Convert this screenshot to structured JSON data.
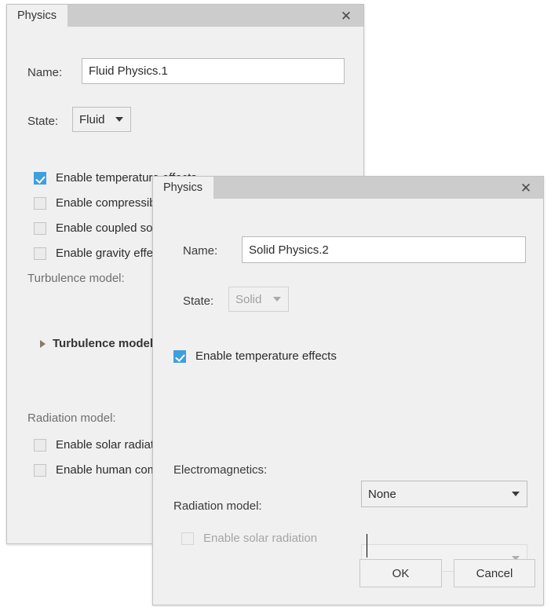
{
  "background_dialog": {
    "tab_label": "Physics",
    "close_icon": "close-icon",
    "name": {
      "label": "Name:",
      "value": "Fluid Physics.1"
    },
    "state": {
      "label": "State:",
      "value": "Fluid",
      "enabled": true
    },
    "checkboxes": [
      {
        "label": "Enable temperature effects",
        "checked": true,
        "enabled": true
      },
      {
        "label": "Enable compressibility",
        "checked": false,
        "enabled": true
      },
      {
        "label": "Enable coupled solver",
        "checked": false,
        "enabled": true
      },
      {
        "label": "Enable gravity effects",
        "checked": false,
        "enabled": true
      }
    ],
    "turbulence_section_label": "Turbulence model:",
    "turbulence_tree_item": "Turbulence model",
    "radiation_section_label": "Radiation model:",
    "radiation_checkboxes": [
      {
        "label": "Enable solar radiation",
        "checked": false,
        "enabled": true
      },
      {
        "label": "Enable human comfort",
        "checked": false,
        "enabled": true
      }
    ]
  },
  "foreground_dialog": {
    "tab_label": "Physics",
    "close_icon": "close-icon",
    "name": {
      "label": "Name:",
      "value": "Solid Physics.2"
    },
    "state": {
      "label": "State:",
      "value": "Solid",
      "enabled": false
    },
    "temperature_checkbox": {
      "label": "Enable temperature effects",
      "checked": true,
      "enabled": true
    },
    "electromagnetics": {
      "label": "Electromagnetics:",
      "value": "None",
      "enabled": true
    },
    "radiation_model": {
      "label": "Radiation model:",
      "value": "",
      "enabled": false
    },
    "solar_checkbox": {
      "label": "Enable solar radiation",
      "checked": false,
      "enabled": false
    },
    "buttons": {
      "ok": "OK",
      "cancel": "Cancel"
    }
  },
  "colors": {
    "accent": "#3f9fdc",
    "dialog_bg": "#f0f0f0",
    "titlebar_bg": "#cccccc",
    "border": "#c3c3c3",
    "page_bg": "#ffffff"
  }
}
